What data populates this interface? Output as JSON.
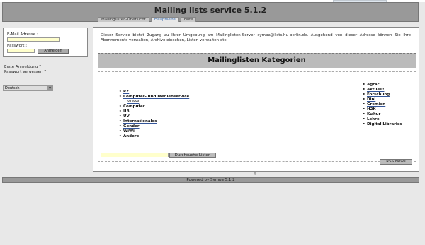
{
  "header": {
    "title": "Mailing lists service 5.1.2"
  },
  "tabs": [
    {
      "label": "Mailinglisten-Übersicht"
    },
    {
      "label": "Hauptseite"
    },
    {
      "label": "Hilfe"
    }
  ],
  "login": {
    "email_label": "E-Mail Adresse :",
    "password_label": "Passwort :",
    "submit_label": "Anmelden"
  },
  "sidebar": {
    "first_login": "Erste Anmeldung ?",
    "forgot_password": "Passwort vergessen ?",
    "language": "Deutsch"
  },
  "main": {
    "intro": "Dieser Service bietet Zugang zu Ihrer Umgebung am Mailinglisten-Server sympa@lists.hu-berlin.de. Ausgehend von dieser Adresse können Sie Ihre Abonnements verwalten, Archive einsehen, Listen verwalten etc.",
    "categories_title": "Mailinglisten Kategorien",
    "col1": [
      "RZ",
      "Computer- und Medienservice",
      "WWW",
      "Computer",
      "UB",
      "UV",
      "Internationales",
      "Gender",
      "WiWi",
      "Andere"
    ],
    "col2": [
      "Agrar",
      "Aktuell!",
      "Forschung",
      "Dini",
      "Gremien",
      "H2K",
      "Kultur",
      "Lehre",
      "Digital Libraries"
    ],
    "search_button": "Durchsuche Listen",
    "rss_button": "RSS News"
  },
  "divider_mark": "§",
  "footer": {
    "text": "Powered by Sympa 5.1.2"
  }
}
